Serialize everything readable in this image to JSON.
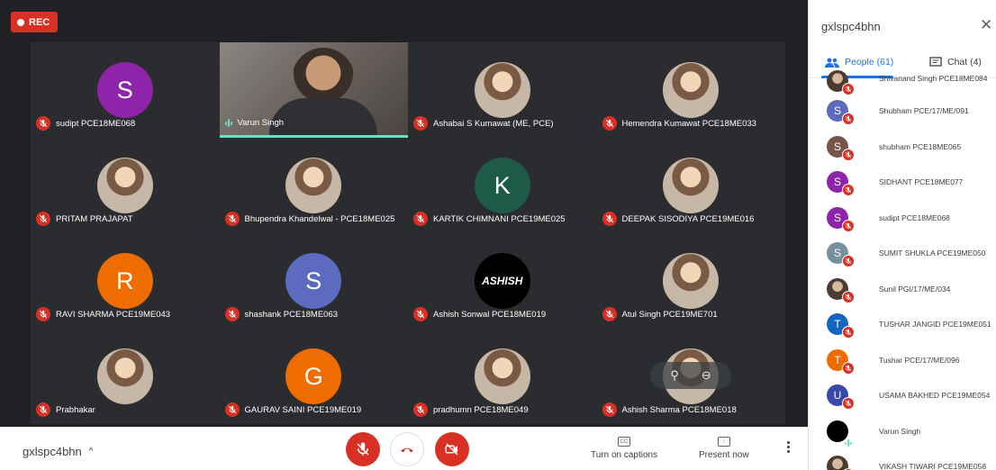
{
  "recording": {
    "label": "REC"
  },
  "meeting_code": "gxlspc4bhn",
  "tiles": [
    {
      "name": "sudipt PCE18ME068",
      "initial": "S",
      "color": "#8e24aa",
      "type": "letter"
    },
    {
      "name": "Varun Singh",
      "initial": "",
      "color": "",
      "type": "video"
    },
    {
      "name": "Ashabai S Kumawat (ME, PCE)",
      "initial": "",
      "color": "",
      "type": "photo"
    },
    {
      "name": "Hemendra Kumawat PCE18ME033",
      "initial": "",
      "color": "",
      "type": "photo"
    },
    {
      "name": "PRITAM PRAJAPAT",
      "initial": "",
      "color": "",
      "type": "photo"
    },
    {
      "name": "Bhupendra Khandelwal - PCE18ME025",
      "initial": "",
      "color": "",
      "type": "photo"
    },
    {
      "name": "KARTIK CHIMNANI PCE19ME025",
      "initial": "K",
      "color": "#1e5a48",
      "type": "letter"
    },
    {
      "name": "DEEPAK SISODIYA PCE19ME016",
      "initial": "",
      "color": "",
      "type": "photo"
    },
    {
      "name": "RAVI SHARMA PCE19ME043",
      "initial": "R",
      "color": "#ef6c00",
      "type": "letter"
    },
    {
      "name": "shashank PCE18ME063",
      "initial": "S",
      "color": "#5c6bc0",
      "type": "letter"
    },
    {
      "name": "Ashish Sonwal PCE18ME019",
      "initial": "ASHISH",
      "color": "#000000",
      "type": "logo"
    },
    {
      "name": "Atul Singh PCE19ME701",
      "initial": "",
      "color": "",
      "type": "photo"
    },
    {
      "name": "Prabhakar",
      "initial": "",
      "color": "",
      "type": "photo"
    },
    {
      "name": "GAURAV SAINI PCE19ME019",
      "initial": "G",
      "color": "#ef6c00",
      "type": "letter"
    },
    {
      "name": "pradhumn PCE18ME049",
      "initial": "",
      "color": "",
      "type": "photo"
    },
    {
      "name": "Ashish Sharma PCE18ME018",
      "initial": "",
      "color": "",
      "type": "photo"
    }
  ],
  "bottom_bar": {
    "captions_label": "Turn on captions",
    "captions_icon_text": "CC",
    "present_label": "Present now"
  },
  "panel": {
    "title": "gxlspc4bhn",
    "people_tab": "People (61)",
    "chat_tab": "Chat (4)",
    "participants": [
      {
        "name": "Shivanand Singh PCE18ME084",
        "initial": "",
        "color": "",
        "type": "photo",
        "muted": true
      },
      {
        "name": "Shubham PCE/17/ME/091",
        "initial": "S",
        "color": "#5c6bc0",
        "type": "letter",
        "muted": true
      },
      {
        "name": "shubham PCE18ME065",
        "initial": "S",
        "color": "#795548",
        "type": "letter",
        "muted": true
      },
      {
        "name": "SIDHANT PCE18ME077",
        "initial": "S",
        "color": "#8e24aa",
        "type": "letter",
        "muted": true
      },
      {
        "name": "sudipt PCE18ME068",
        "initial": "S",
        "color": "#8e24aa",
        "type": "letter",
        "muted": true
      },
      {
        "name": "SUMIT SHUKLA PCE19ME050",
        "initial": "S",
        "color": "#78909c",
        "type": "letter",
        "muted": true
      },
      {
        "name": "Sunil PGI/17/ME/034",
        "initial": "",
        "color": "",
        "type": "photo",
        "muted": true
      },
      {
        "name": "TUSHAR JANGID PCE19ME051",
        "initial": "T",
        "color": "#1565c0",
        "type": "letter",
        "muted": true
      },
      {
        "name": "Tushar PCE/17/ME/096",
        "initial": "T",
        "color": "#ef6c00",
        "type": "letter",
        "muted": true
      },
      {
        "name": "USAMA BAKHED PCE19ME054",
        "initial": "U",
        "color": "#3949ab",
        "type": "letter",
        "muted": true
      },
      {
        "name": "Varun Singh",
        "initial": "",
        "color": "#000000",
        "type": "black",
        "muted": false
      },
      {
        "name": "VIKASH TIWARI PCE19ME058",
        "initial": "",
        "color": "",
        "type": "photo",
        "muted": true
      }
    ]
  }
}
